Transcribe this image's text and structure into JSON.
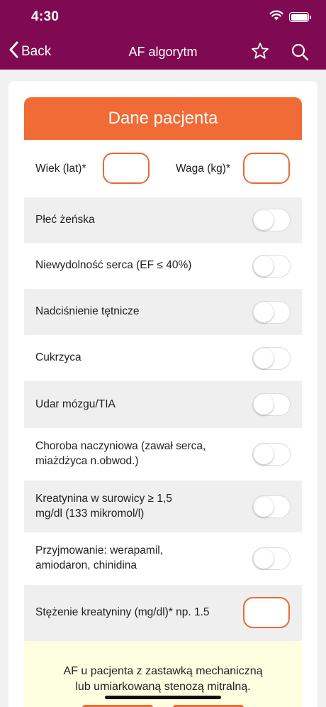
{
  "status_bar": {
    "time": "4:30"
  },
  "nav": {
    "back_label": "Back",
    "title": "AF algorytm"
  },
  "section": {
    "header": "Dane pacjenta"
  },
  "inputs": {
    "age_label": "Wiek (lat)*",
    "age_value": "",
    "weight_label": "Waga (kg)*",
    "weight_value": "",
    "creatinine_label": "Stężenie kreatyniny (mg/dl)* np. 1.5",
    "creatinine_value": ""
  },
  "toggles": [
    {
      "label": "Płeć żeńska",
      "on": false
    },
    {
      "label": "Niewydolność serca (EF ≤ 40%)",
      "on": false
    },
    {
      "label": "Nadciśnienie tętnicze",
      "on": false
    },
    {
      "label": "Cukrzyca",
      "on": false
    },
    {
      "label": "Udar mózgu/TIA",
      "on": false
    },
    {
      "label": "Choroba naczyniowa (zawał serca, miażdżyca n.obwod.)",
      "on": false
    },
    {
      "label": "Kreatynina w surowicy ≥ 1,5 mg/dl (133 mikromol/l)",
      "on": false
    },
    {
      "label": "Przyjmowanie: werapamil, amiodaron, chinidina",
      "on": false
    }
  ],
  "question": {
    "line1": "AF u pacjenta z zastawką mechaniczną",
    "line2": "lub umiarkowaną stenozą mitralną."
  },
  "colors": {
    "brand": "#7f0a52",
    "accent": "#f06b35",
    "note_bg": "#fefee0"
  }
}
